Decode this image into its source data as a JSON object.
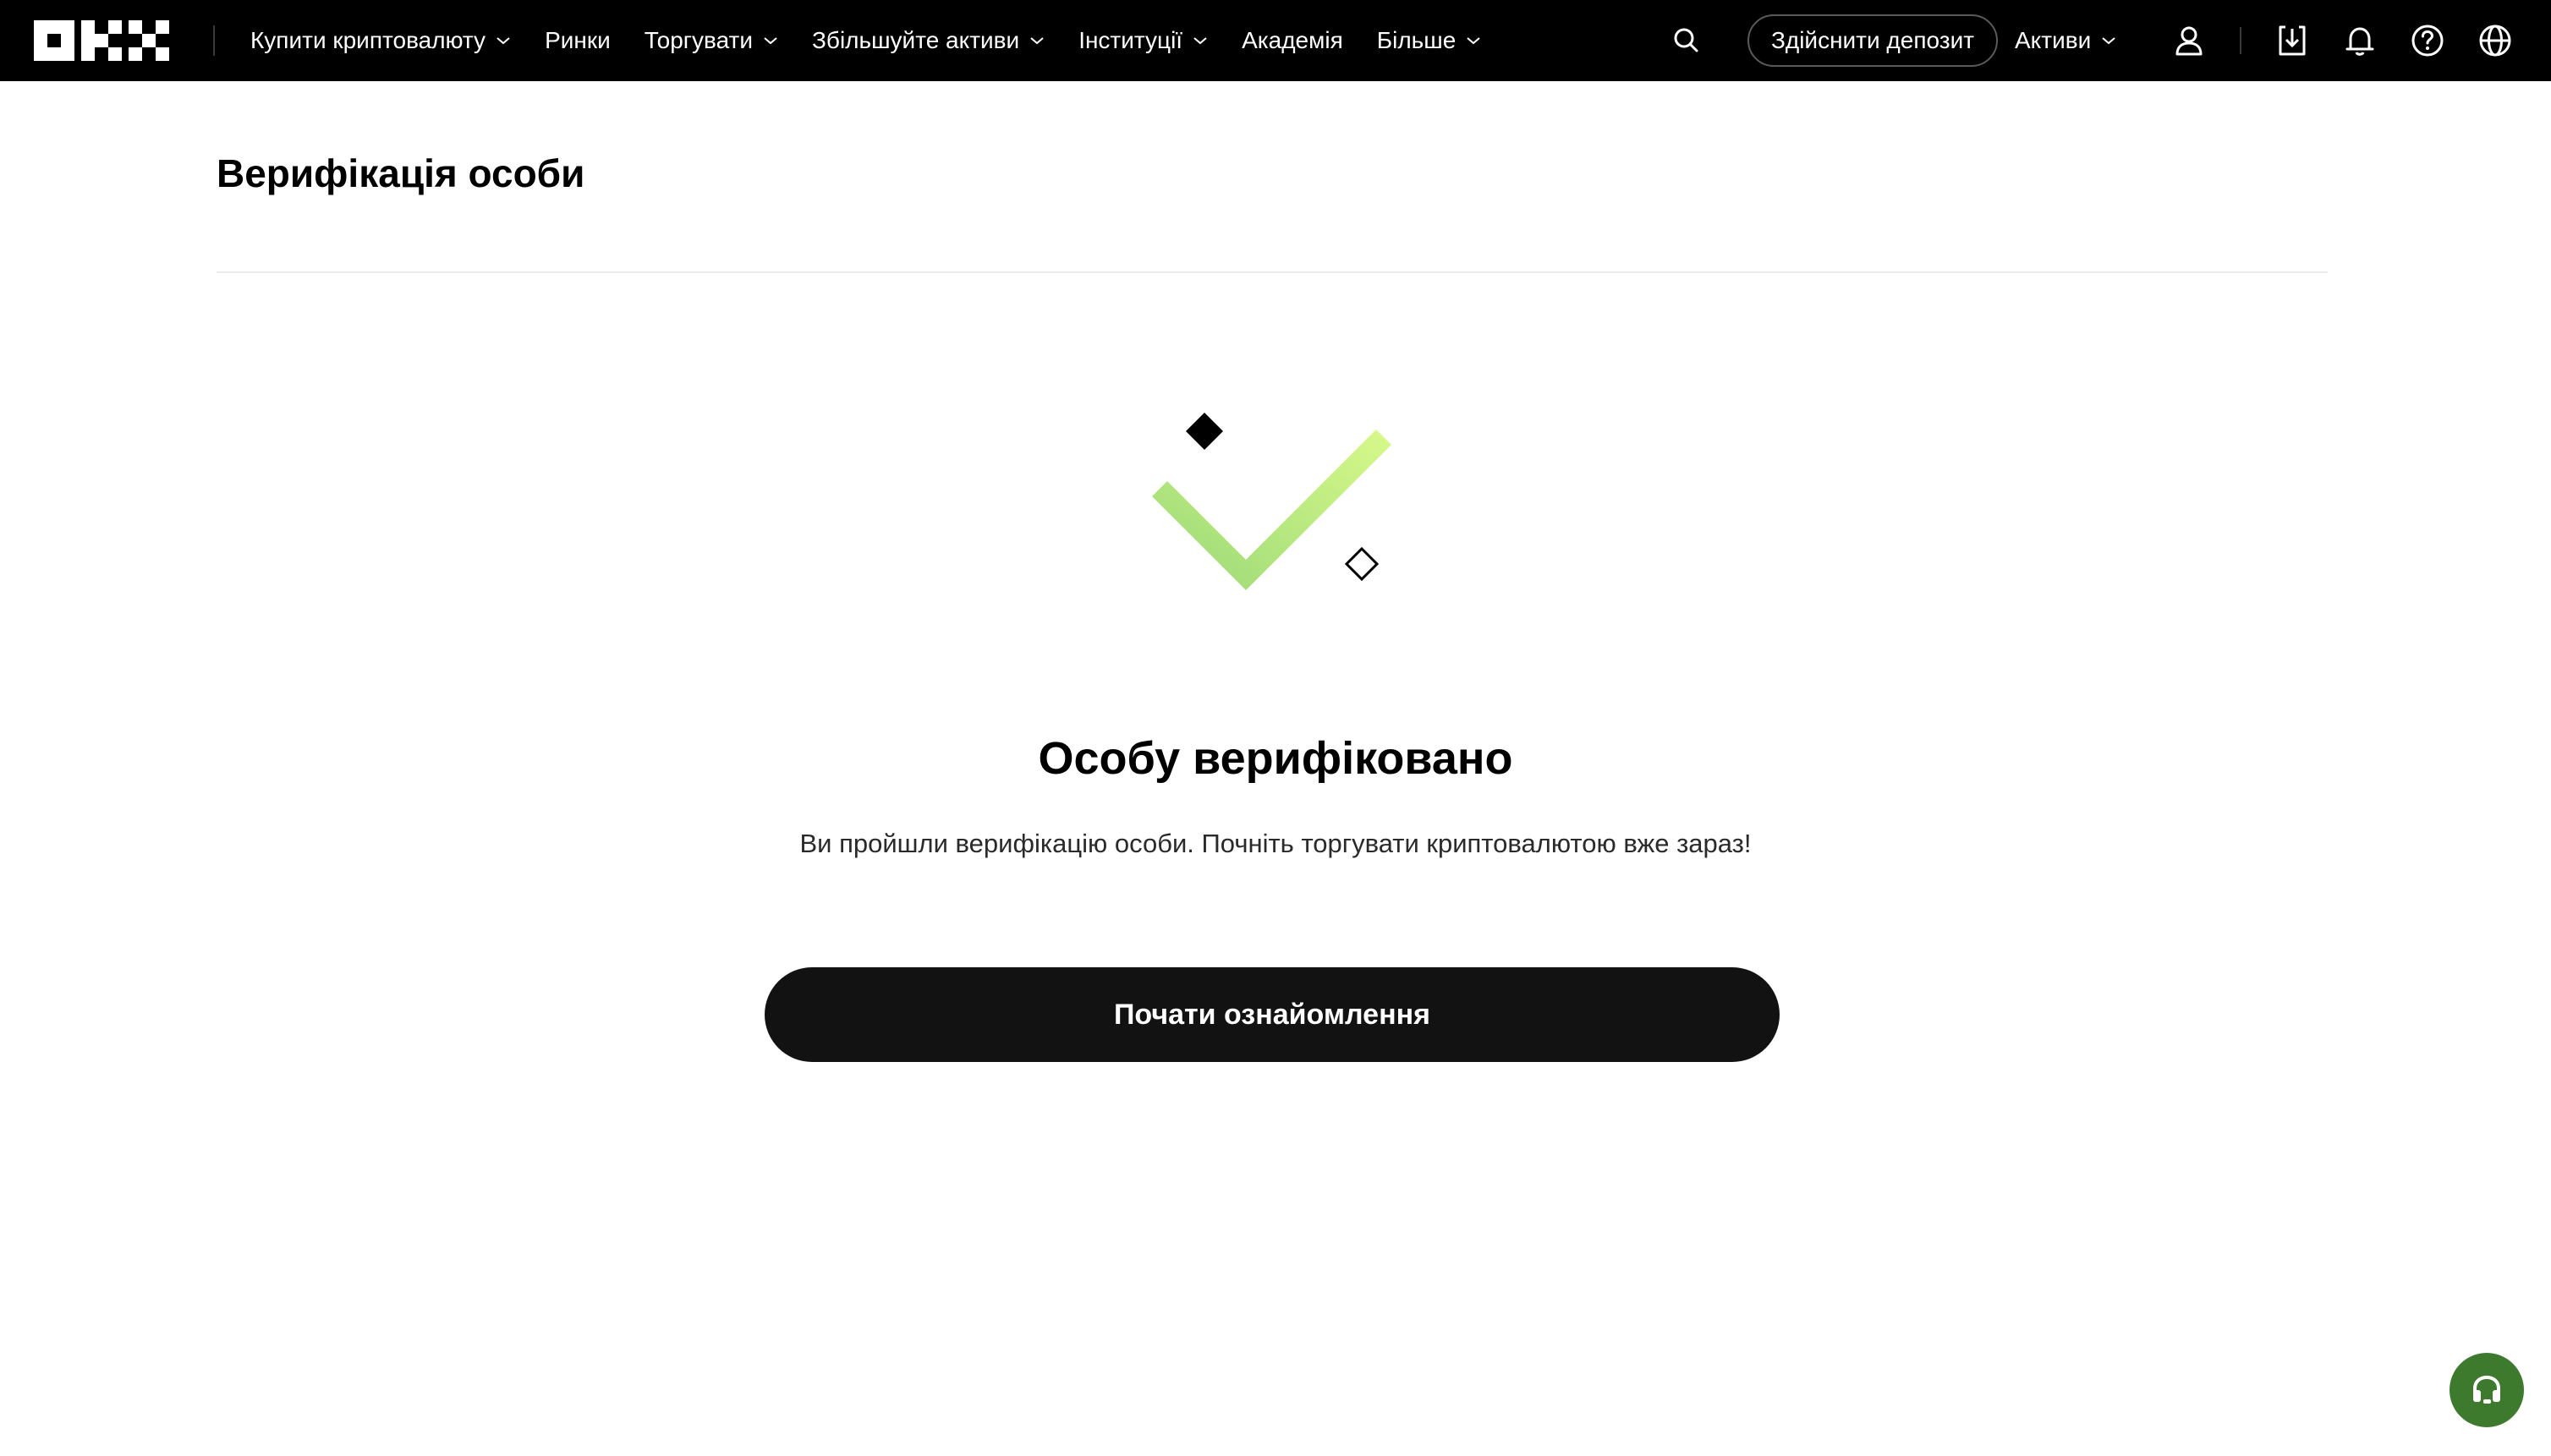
{
  "app": {
    "brand": "OKX"
  },
  "nav": {
    "items": [
      {
        "label": "Купити криптовалюту",
        "has_dropdown": true
      },
      {
        "label": "Ринки",
        "has_dropdown": false
      },
      {
        "label": "Торгувати",
        "has_dropdown": true
      },
      {
        "label": "Збільшуйте активи",
        "has_dropdown": true
      },
      {
        "label": "Інституції",
        "has_dropdown": true
      },
      {
        "label": "Академія",
        "has_dropdown": false
      },
      {
        "label": "Більше",
        "has_dropdown": true
      }
    ],
    "deposit_label": "Здійснити депозит",
    "assets_label": "Активи",
    "icons": [
      "search-icon",
      "user-icon",
      "download-icon",
      "bell-icon",
      "help-icon",
      "globe-icon"
    ]
  },
  "page": {
    "title": "Верифікація особи"
  },
  "result": {
    "heading": "Особу верифіковано",
    "description": "Ви пройшли верифікацію особи. Почніть торгувати криптовалютою вже зараз!",
    "button_label": "Почати ознайомлення"
  },
  "support": {
    "icon": "headset-icon"
  },
  "colors": {
    "nav_bg": "#000000",
    "primary_button": "#121212",
    "check_light": "#d8f98a",
    "check_dark": "#9ad877",
    "support_fab": "#3d7a2e"
  }
}
